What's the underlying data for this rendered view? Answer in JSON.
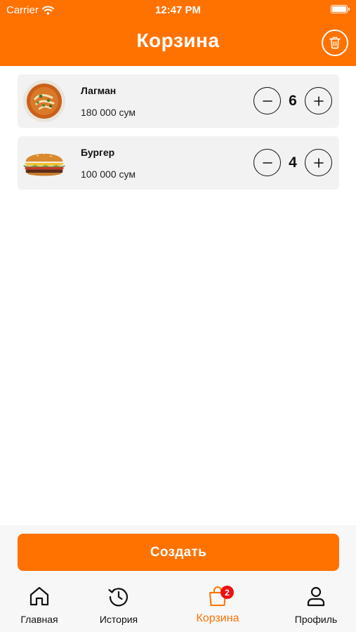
{
  "status_bar": {
    "carrier": "Carrier",
    "time": "12:47 PM"
  },
  "header": {
    "title": "Корзина",
    "trash_icon": "trash-icon"
  },
  "cart": {
    "items": [
      {
        "name": "Лагман",
        "price": "180 000 сум",
        "quantity": "6",
        "image": "lagman-bowl-image"
      },
      {
        "name": "Бургер",
        "price": "100 000 сум",
        "quantity": "4",
        "image": "burger-image"
      }
    ]
  },
  "actions": {
    "create_label": "Создать"
  },
  "tab_bar": {
    "items": [
      {
        "label": "Главная",
        "icon": "home-icon"
      },
      {
        "label": "История",
        "icon": "history-icon"
      },
      {
        "label": "Корзина",
        "icon": "cart-bag-icon",
        "badge": "2",
        "active": true
      },
      {
        "label": "Профиль",
        "icon": "profile-icon"
      }
    ]
  },
  "colors": {
    "accent": "#ff7200",
    "badge": "#ee1111",
    "card": "#f2f2f2"
  }
}
